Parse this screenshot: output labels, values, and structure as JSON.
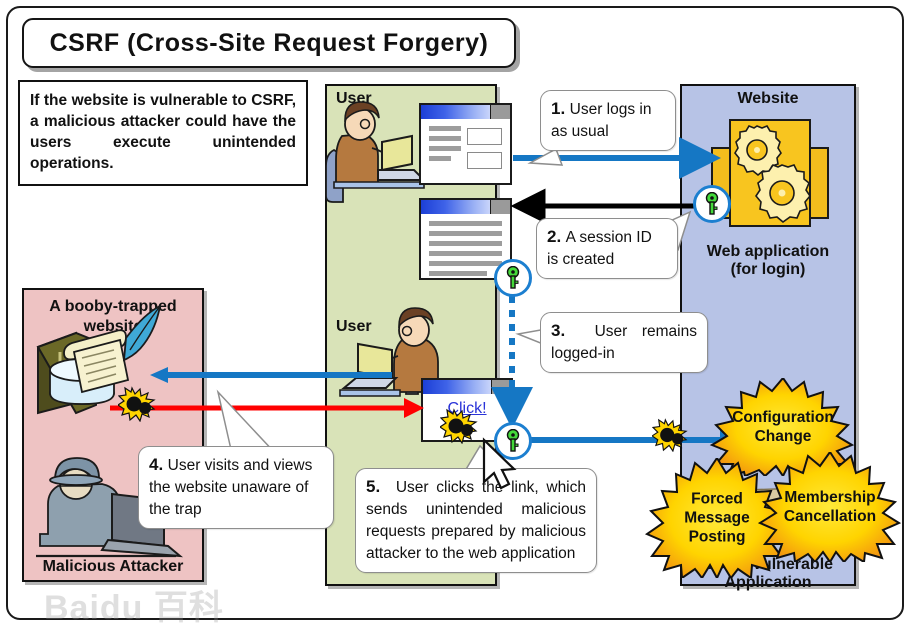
{
  "title": "CSRF (Cross-Site Request Forgery)",
  "description": "If the website is vulnerable to CSRF, a malicious attacker could have the users execute unintended operations.",
  "panels": {
    "user_top": {
      "label": "User",
      "color": "#d9e3b8"
    },
    "user_bottom": {
      "label": "User",
      "color": "#d9e3b8"
    },
    "booby": {
      "label_line1": "A booby-trapped",
      "label_line2": "website",
      "attacker_label": "Malicious Attacker",
      "color": "#eec3c3"
    },
    "website": {
      "label": "Website",
      "app_line1": "Web application",
      "app_line2": "(for login)",
      "vuln_line1": "CSRF-Vulnerable",
      "vuln_line2": "Application",
      "color": "#b7c3e6"
    }
  },
  "steps": [
    {
      "num": "1.",
      "text": "User logs in as usual"
    },
    {
      "num": "2.",
      "text": "A session ID is created"
    },
    {
      "num": "3.",
      "text": "User remains logged-in"
    },
    {
      "num": "4.",
      "text": "User visits and views the website unaware of the trap"
    },
    {
      "num": "5.",
      "text": "User clicks the link, which sends unintended malicious requests prepared by malicious attacker to the web application"
    }
  ],
  "bursts": [
    {
      "name": "configuration-change",
      "line1": "Configuration",
      "line2": "Change"
    },
    {
      "name": "forced-message-posting",
      "line1": "Forced",
      "line2": "Message",
      "line3": "Posting"
    },
    {
      "name": "membership-cancellation",
      "line1": "Membership",
      "line2": "Cancellation"
    }
  ],
  "click_link": "Click!",
  "watermark": {
    "text": "Baidu",
    "text_cn": "百科"
  },
  "colors": {
    "green_panel": "#d9e3b8",
    "pink_panel": "#eec3c3",
    "blue_panel": "#b7c3e6",
    "arrow_blue": "#1577c4",
    "arrow_red": "#ff0000",
    "arrow_black": "#000000",
    "key_green": "#44d93a",
    "gear_yellow": "#f5bb10",
    "burst_yellow": "#ffd400",
    "burst_orange": "#f08b12"
  }
}
